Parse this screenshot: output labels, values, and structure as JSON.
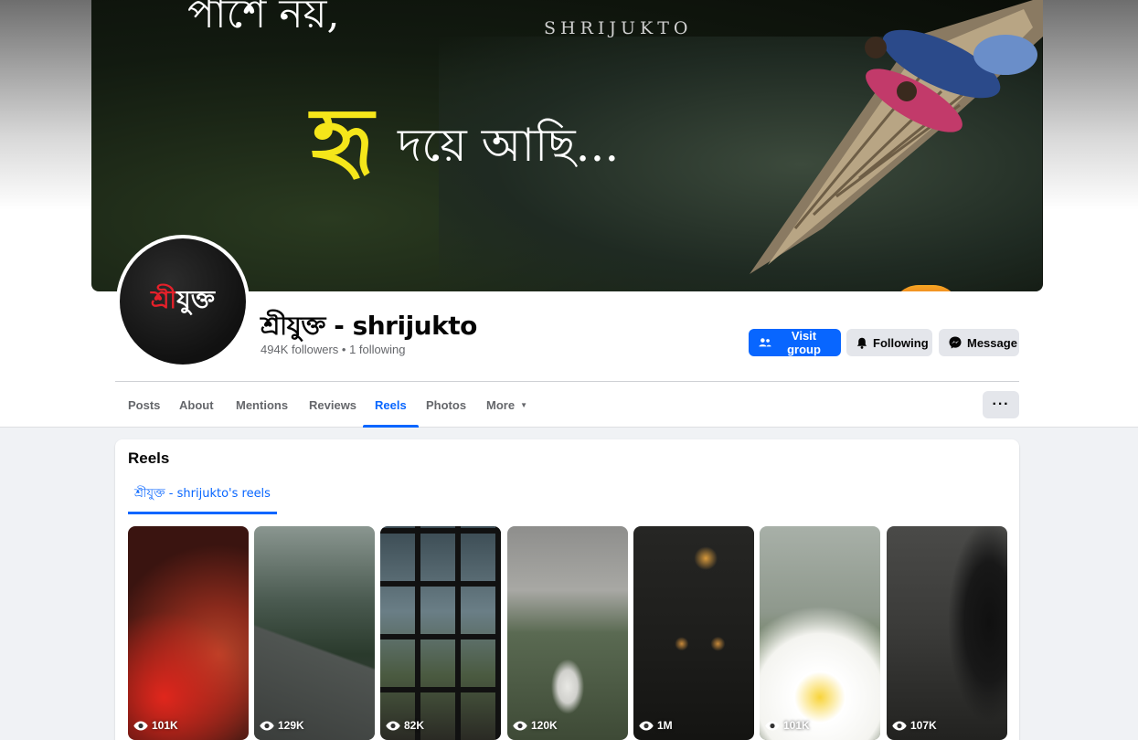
{
  "cover": {
    "top_text": "পাশে নয়,",
    "brand_text": "SHRIJUKTO",
    "headline_yellow": "হৃ",
    "headline_white": "দয়ে আছি..."
  },
  "avatar": {
    "logo_red": "শ্রী",
    "logo_white": "যুক্ত"
  },
  "page": {
    "name": "শ্রীযুক্ত - shrijukto",
    "followers": "494K followers",
    "separator": " • ",
    "following": "1 following"
  },
  "actions": {
    "visit_group": "Visit group",
    "following": "Following",
    "message": "Message"
  },
  "tabs": [
    {
      "label": "Posts",
      "active": false
    },
    {
      "label": "About",
      "active": false
    },
    {
      "label": "Mentions",
      "active": false
    },
    {
      "label": "Reviews",
      "active": false
    },
    {
      "label": "Reels",
      "active": true
    },
    {
      "label": "Photos",
      "active": false
    },
    {
      "label": "More",
      "active": false
    }
  ],
  "more_menu_label": "···",
  "reels_section": {
    "title": "Reels",
    "subtab": "শ্রীযুক্ত - shrijukto's reels",
    "items": [
      {
        "views": "101K",
        "icon": "eye-icon"
      },
      {
        "views": "129K",
        "icon": "eye-icon"
      },
      {
        "views": "82K",
        "icon": "eye-icon"
      },
      {
        "views": "120K",
        "icon": "eye-icon"
      },
      {
        "views": "1M",
        "icon": "eye-icon"
      },
      {
        "views": "101K",
        "icon": "eye-icon"
      },
      {
        "views": "107K",
        "icon": "eye-icon"
      }
    ]
  },
  "colors": {
    "accent": "#0866ff",
    "button_grey": "#e4e6eb",
    "text_secondary": "#65676b",
    "background": "#f0f2f5"
  }
}
